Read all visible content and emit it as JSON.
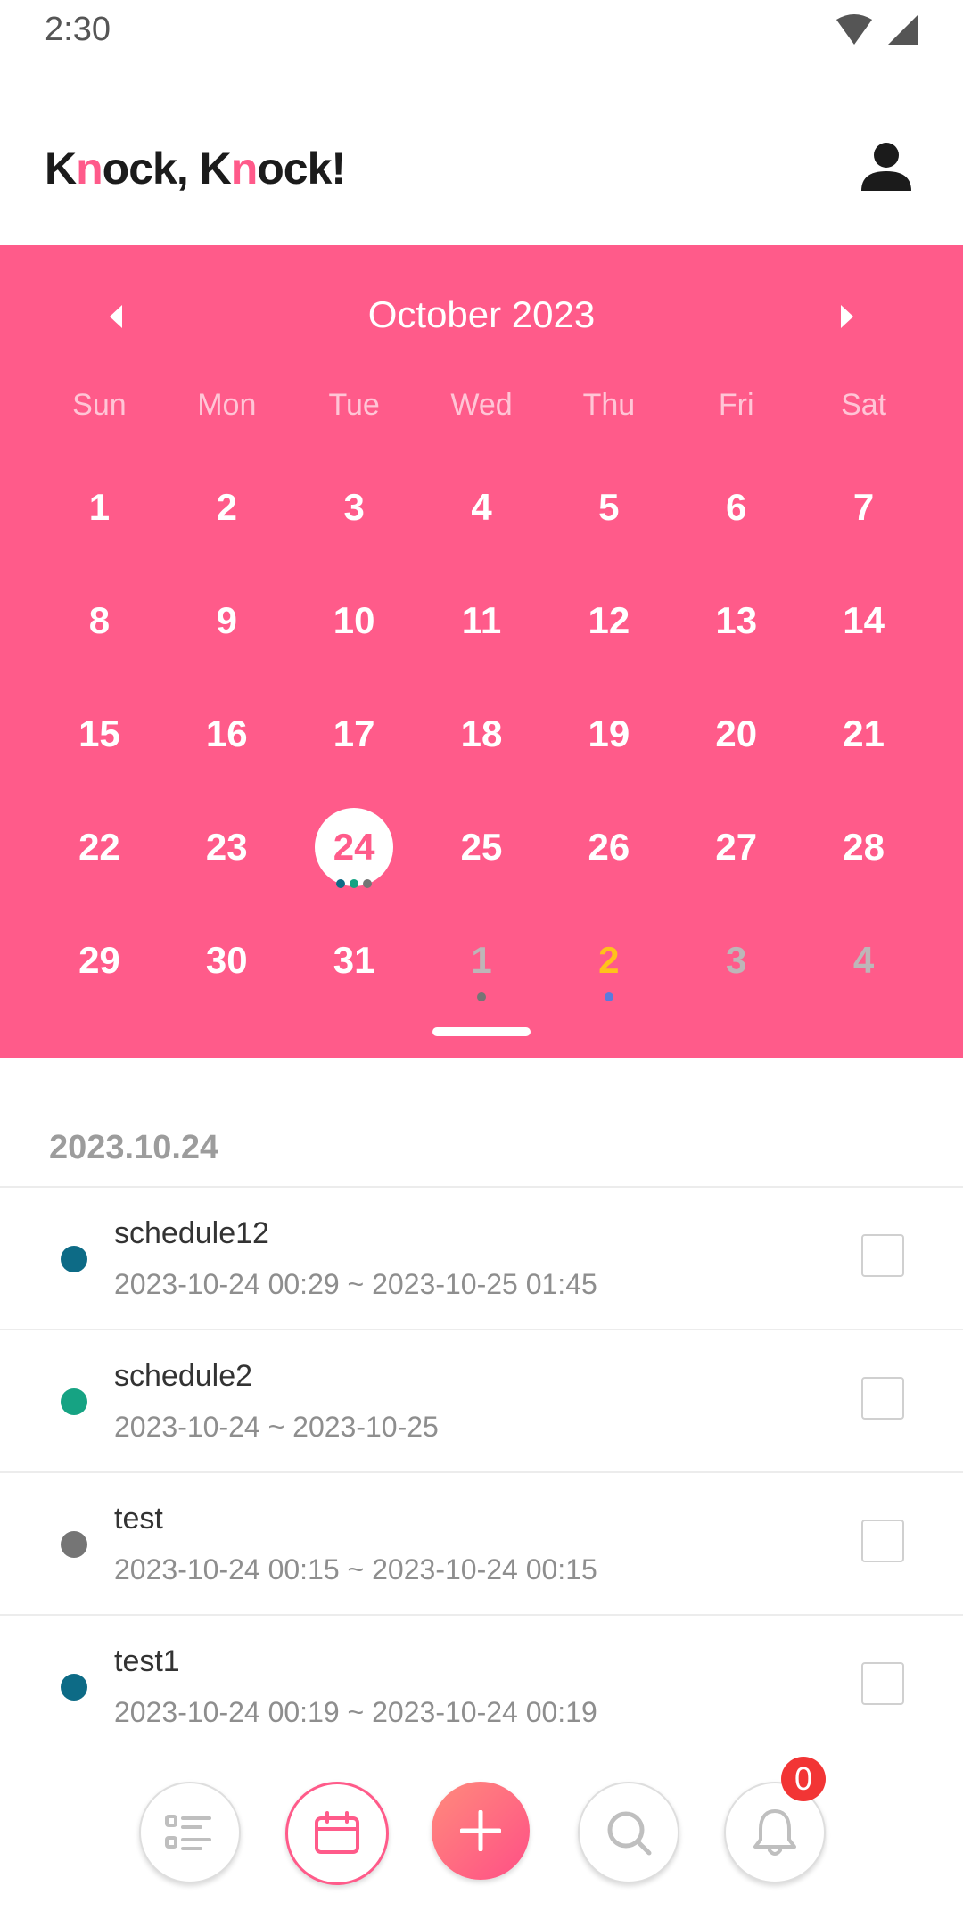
{
  "status_bar": {
    "time": "2:30"
  },
  "app": {
    "logo_part1": "K",
    "logo_n1": "n",
    "logo_part2": "ock, K",
    "logo_n2": "n",
    "logo_part3": "ock!"
  },
  "calendar": {
    "month_title": "October 2023",
    "weekdays": [
      "Sun",
      "Mon",
      "Tue",
      "Wed",
      "Thu",
      "Fri",
      "Sat"
    ],
    "weeks": [
      [
        "1",
        "2",
        "3",
        "4",
        "5",
        "6",
        "7"
      ],
      [
        "8",
        "9",
        "10",
        "11",
        "12",
        "13",
        "14"
      ],
      [
        "15",
        "16",
        "17",
        "18",
        "19",
        "20",
        "21"
      ],
      [
        "22",
        "23",
        "24",
        "25",
        "26",
        "27",
        "28"
      ],
      [
        "29",
        "30",
        "31",
        "1",
        "2",
        "3",
        "4"
      ]
    ],
    "selected_day": "24"
  },
  "schedule": {
    "date_label": "2023.10.24",
    "items": [
      {
        "title": "schedule12",
        "range": "2023-10-24 00:29 ~ 2023-10-25 01:45",
        "color": "#0d6b86"
      },
      {
        "title": "schedule2",
        "range": "2023-10-24 ~ 2023-10-25",
        "color": "#16a383"
      },
      {
        "title": "test",
        "range": "2023-10-24 00:15 ~ 2023-10-24 00:15",
        "color": "#757575"
      },
      {
        "title": "test1",
        "range": "2023-10-24 00:19 ~ 2023-10-24 00:19",
        "color": "#0d6b86"
      }
    ]
  },
  "bottom_nav": {
    "notifications_badge": "0",
    "items": [
      "list-icon",
      "calendar-icon",
      "plus-icon",
      "search-icon",
      "bell-icon"
    ]
  },
  "colors": {
    "accent": "#ff5b8a",
    "accent_light": "#ff8b7c",
    "highlight": "#ffc21a",
    "badge": "#f23535"
  }
}
